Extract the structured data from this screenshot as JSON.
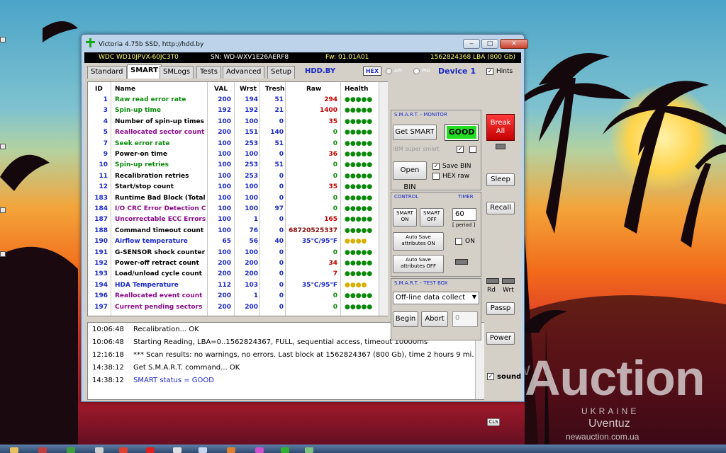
{
  "window": {
    "title": "Victoria 4.75b SSD, http://hdd.by",
    "controls": {
      "minimize": "‒",
      "maximize": "□",
      "close": "✕"
    }
  },
  "drive_info": {
    "model": "WDC WD10JPVX-60JC3T0",
    "serial": "SN: WD-WXV1E26AERF8",
    "firmware": "Fw: 01.01A01",
    "lba": "1562824368 LBA (800 Gb)"
  },
  "tabs": [
    "Standard",
    "SMART",
    "SMLogs",
    "Tests",
    "Advanced",
    "Setup"
  ],
  "active_tab": "SMART",
  "toolbar": {
    "site": "HDD.BY",
    "hex": "HEX",
    "api": "API",
    "pio": "PIO",
    "device": "Device 1",
    "hints": "Hints"
  },
  "smart_table": {
    "columns": [
      "ID",
      "Name",
      "VAL",
      "Wrst",
      "Tresh",
      "Raw",
      "Health"
    ],
    "rows": [
      {
        "id": "1",
        "name": "Raw read error rate",
        "val": "200",
        "wrst": "194",
        "tresh": "51",
        "raw": "294",
        "health": "●●●●●",
        "name_color": "#0a8a0a",
        "raw_color": "#c00000",
        "health_color": "#0a8a0a"
      },
      {
        "id": "3",
        "name": "Spin-up time",
        "val": "192",
        "wrst": "192",
        "tresh": "21",
        "raw": "1400",
        "health": "●●●●●",
        "name_color": "#0a8a0a",
        "raw_color": "#c00000",
        "health_color": "#0a8a0a"
      },
      {
        "id": "4",
        "name": "Number of spin-up times",
        "val": "100",
        "wrst": "100",
        "tresh": "0",
        "raw": "35",
        "health": "●●●●●",
        "name_color": "#000000",
        "raw_color": "#c00000",
        "health_color": "#0a8a0a"
      },
      {
        "id": "5",
        "name": "Reallocated sector count",
        "val": "200",
        "wrst": "151",
        "tresh": "140",
        "raw": "0",
        "health": "●●●●●",
        "name_color": "#8a0a8a",
        "raw_color": "#0a8a0a",
        "health_color": "#0a8a0a"
      },
      {
        "id": "7",
        "name": "Seek error rate",
        "val": "100",
        "wrst": "253",
        "tresh": "51",
        "raw": "0",
        "health": "●●●●●",
        "name_color": "#0a8a0a",
        "raw_color": "#0a8a0a",
        "health_color": "#0a8a0a"
      },
      {
        "id": "9",
        "name": "Power-on time",
        "val": "100",
        "wrst": "100",
        "tresh": "0",
        "raw": "36",
        "health": "●●●●●",
        "name_color": "#000000",
        "raw_color": "#c00000",
        "health_color": "#0a8a0a"
      },
      {
        "id": "10",
        "name": "Spin-up retries",
        "val": "100",
        "wrst": "253",
        "tresh": "51",
        "raw": "0",
        "health": "●●●●●",
        "name_color": "#0a8a0a",
        "raw_color": "#0a8a0a",
        "health_color": "#0a8a0a"
      },
      {
        "id": "11",
        "name": "Recalibration retries",
        "val": "100",
        "wrst": "253",
        "tresh": "0",
        "raw": "0",
        "health": "●●●●●",
        "name_color": "#000000",
        "raw_color": "#0a8a0a",
        "health_color": "#0a8a0a"
      },
      {
        "id": "12",
        "name": "Start/stop count",
        "val": "100",
        "wrst": "100",
        "tresh": "0",
        "raw": "35",
        "health": "●●●●●",
        "name_color": "#000000",
        "raw_color": "#c00000",
        "health_color": "#0a8a0a"
      },
      {
        "id": "183",
        "name": "Runtime Bad Block (Total)",
        "val": "100",
        "wrst": "100",
        "tresh": "0",
        "raw": "0",
        "health": "●●●●●",
        "name_color": "#000000",
        "raw_color": "#0a8a0a",
        "health_color": "#0a8a0a"
      },
      {
        "id": "184",
        "name": "I/O CRC Error Detection C...",
        "val": "100",
        "wrst": "100",
        "tresh": "97",
        "raw": "0",
        "health": "●●●●●",
        "name_color": "#8a0a8a",
        "raw_color": "#0a8a0a",
        "health_color": "#0a8a0a"
      },
      {
        "id": "187",
        "name": "Uncorrectable ECC Errors",
        "val": "100",
        "wrst": "1",
        "tresh": "0",
        "raw": "165",
        "health": "●●●●●",
        "name_color": "#8a0a8a",
        "raw_color": "#c00000",
        "health_color": "#0a8a0a"
      },
      {
        "id": "188",
        "name": "Command timeout count",
        "val": "100",
        "wrst": "76",
        "tresh": "0",
        "raw": "68720525337",
        "health": "●●●●●",
        "name_color": "#000000",
        "raw_color": "#8a0a0a",
        "health_color": "#0a8a0a"
      },
      {
        "id": "190",
        "name": "Airflow temperature",
        "val": "65",
        "wrst": "56",
        "tresh": "40",
        "raw": "35°C/95°F",
        "health": "●●●●",
        "name_color": "#1a28c8",
        "raw_color": "#1a28c8",
        "health_color": "#d8b000"
      },
      {
        "id": "191",
        "name": "G-SENSOR shock counter",
        "val": "100",
        "wrst": "100",
        "tresh": "0",
        "raw": "0",
        "health": "●●●●●",
        "name_color": "#000000",
        "raw_color": "#0a8a0a",
        "health_color": "#0a8a0a"
      },
      {
        "id": "192",
        "name": "Power-off retract count",
        "val": "200",
        "wrst": "200",
        "tresh": "0",
        "raw": "34",
        "health": "●●●●●",
        "name_color": "#000000",
        "raw_color": "#c00000",
        "health_color": "#0a8a0a"
      },
      {
        "id": "193",
        "name": "Load/unload cycle count",
        "val": "200",
        "wrst": "200",
        "tresh": "0",
        "raw": "7",
        "health": "●●●●●",
        "name_color": "#000000",
        "raw_color": "#c00000",
        "health_color": "#0a8a0a"
      },
      {
        "id": "194",
        "name": "HDA Temperature",
        "val": "112",
        "wrst": "103",
        "tresh": "0",
        "raw": "35°C/95°F",
        "health": "●●●●",
        "name_color": "#1a28c8",
        "raw_color": "#1a28c8",
        "health_color": "#d8b000"
      },
      {
        "id": "196",
        "name": "Reallocated event count",
        "val": "200",
        "wrst": "1",
        "tresh": "0",
        "raw": "0",
        "health": "●●●●●",
        "name_color": "#8a0a8a",
        "raw_color": "#0a8a0a",
        "health_color": "#0a8a0a"
      },
      {
        "id": "197",
        "name": "Current pending sectors",
        "val": "200",
        "wrst": "200",
        "tresh": "0",
        "raw": "0",
        "health": "●●●●●",
        "name_color": "#8a0a8a",
        "raw_color": "#0a8a0a",
        "health_color": "#0a8a0a"
      }
    ]
  },
  "smart_monitor": {
    "title": "S.M.A.R.T. - MONITOR",
    "get_smart": "Get SMART",
    "status": "GOOD",
    "ibm": "IBM super smart",
    "open_bin": "Open BIN",
    "save_bin": "Save BIN",
    "hex_raw": "HEX raw"
  },
  "control": {
    "title": "CONTROL",
    "timer_title": "TIMER",
    "smart_on": "SMART ON",
    "smart_off": "SMART OFF",
    "timer_value": "60",
    "period": "[ period ]",
    "autosave_on": "Auto Save attributes ON",
    "autosave_off": "Auto Save attributes OFF",
    "on_label": "ON"
  },
  "test_box": {
    "title": "S.M.A.R.T. - TEST BOX",
    "test_selected": "Off-line data collect",
    "begin": "Begin",
    "abort": "Abort",
    "progress": "0"
  },
  "side": {
    "break_all": "Break All",
    "sleep": "Sleep",
    "recall": "Recall",
    "rd": "Rd",
    "wrt": "Wrt",
    "passp": "Passp",
    "power": "Power",
    "sound": "sound",
    "cls": "CLS"
  },
  "log": [
    {
      "time": "10:06:48",
      "msg": "Recalibration... OK",
      "color": "#000000"
    },
    {
      "time": "10:06:48",
      "msg": "Starting Reading, LBA=0..1562824367, FULL, sequential access, timeout 10000ms",
      "color": "#000000"
    },
    {
      "time": "12:16:18",
      "msg": "*** Scan results: no warnings, no errors. Last block at 1562824367 (800 Gb), time 2 hours 9 mi...",
      "color": "#000000"
    },
    {
      "time": "14:38:12",
      "msg": "Get S.M.A.R.T. command... OK",
      "color": "#000000"
    },
    {
      "time": "14:38:12",
      "msg": "SMART status = GOOD",
      "color": "#1a28c8"
    }
  ],
  "watermark": {
    "prefix": "new",
    "brand": "Auction",
    "country": "UKRAINE",
    "user": "Uventuz",
    "site": "newauction.com.ua"
  },
  "colors": {
    "accent": "#1a28c8",
    "good": "#22dd22",
    "break": "#d40000"
  }
}
